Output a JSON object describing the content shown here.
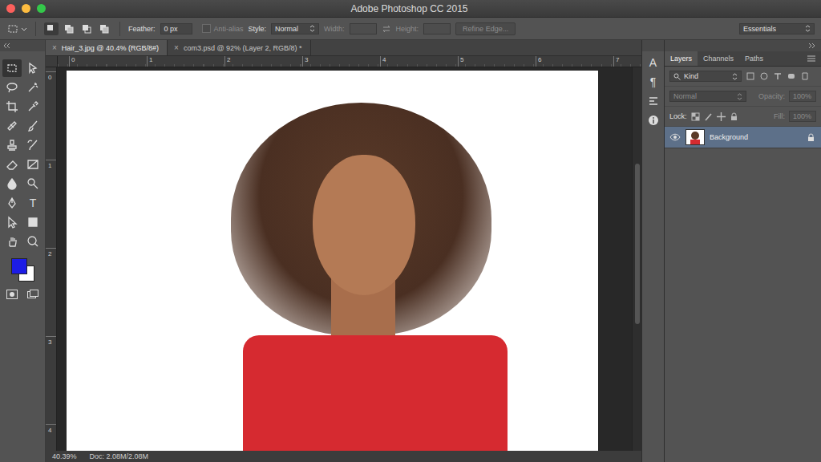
{
  "window": {
    "title": "Adobe Photoshop CC 2015"
  },
  "options_bar": {
    "selection_modes": [
      {
        "selected": true
      },
      {
        "selected": false
      },
      {
        "selected": false
      },
      {
        "selected": false
      }
    ],
    "feather": {
      "label": "Feather:",
      "value": "0 px"
    },
    "anti_alias": {
      "label": "Anti-alias",
      "checked": false,
      "disabled": true
    },
    "style": {
      "label": "Style:",
      "value": "Normal"
    },
    "width": {
      "label": "Width:",
      "disabled": true
    },
    "height": {
      "label": "Height:",
      "disabled": true
    },
    "refine_edge": {
      "label": "Refine Edge...",
      "disabled": true
    },
    "workspace": "Essentials"
  },
  "document_tabs": [
    {
      "label": "Hair_3.jpg @ 40.4% (RGB/8#)",
      "close": "×",
      "selected": true
    },
    {
      "label": "com3.psd @ 92% (Layer 2, RGB/8) *",
      "close": "×",
      "selected": false
    }
  ],
  "rulers": {
    "horizontal": [
      "0",
      "1",
      "2",
      "3",
      "4",
      "5",
      "6",
      "7"
    ],
    "vertical": [
      "0",
      "1",
      "2",
      "3",
      "4"
    ]
  },
  "tools": [
    {
      "selected": true
    },
    {
      "selected": false
    },
    {
      "selected": false
    },
    {
      "selected": false
    },
    {
      "selected": false
    },
    {
      "selected": false
    },
    {
      "selected": false
    },
    {
      "selected": false
    },
    {
      "selected": false
    },
    {
      "selected": false
    },
    {
      "selected": false
    },
    {
      "selected": false
    },
    {
      "selected": false
    },
    {
      "selected": false
    },
    {
      "selected": false
    },
    {
      "selected": false,
      "glyph": "T"
    },
    {
      "selected": false
    },
    {
      "selected": false
    },
    {
      "selected": false
    },
    {
      "selected": false
    }
  ],
  "color_swatches": {
    "foreground": "#1c1ce6",
    "background": "#ffffff"
  },
  "icon_strip": [
    {
      "glyph": "A"
    },
    {
      "glyph": "¶"
    }
  ],
  "panels": {
    "tabs": [
      {
        "label": "Layers",
        "selected": true
      },
      {
        "label": "Channels",
        "selected": false
      },
      {
        "label": "Paths",
        "selected": false
      }
    ],
    "filter": {
      "value": "Kind"
    },
    "blend_mode": {
      "value": "Normal",
      "disabled": true
    },
    "opacity": {
      "label": "Opacity:",
      "value": "100%",
      "disabled": true
    },
    "lock": {
      "label": "Lock:"
    },
    "fill": {
      "label": "Fill:",
      "value": "100%",
      "disabled": true
    }
  },
  "layers": [
    {
      "name": "Background",
      "visible": true,
      "selected": true,
      "locked": true
    }
  ],
  "status_bar": {
    "zoom": "40.39%",
    "doc": "Doc: 2.08M/2.08M"
  }
}
